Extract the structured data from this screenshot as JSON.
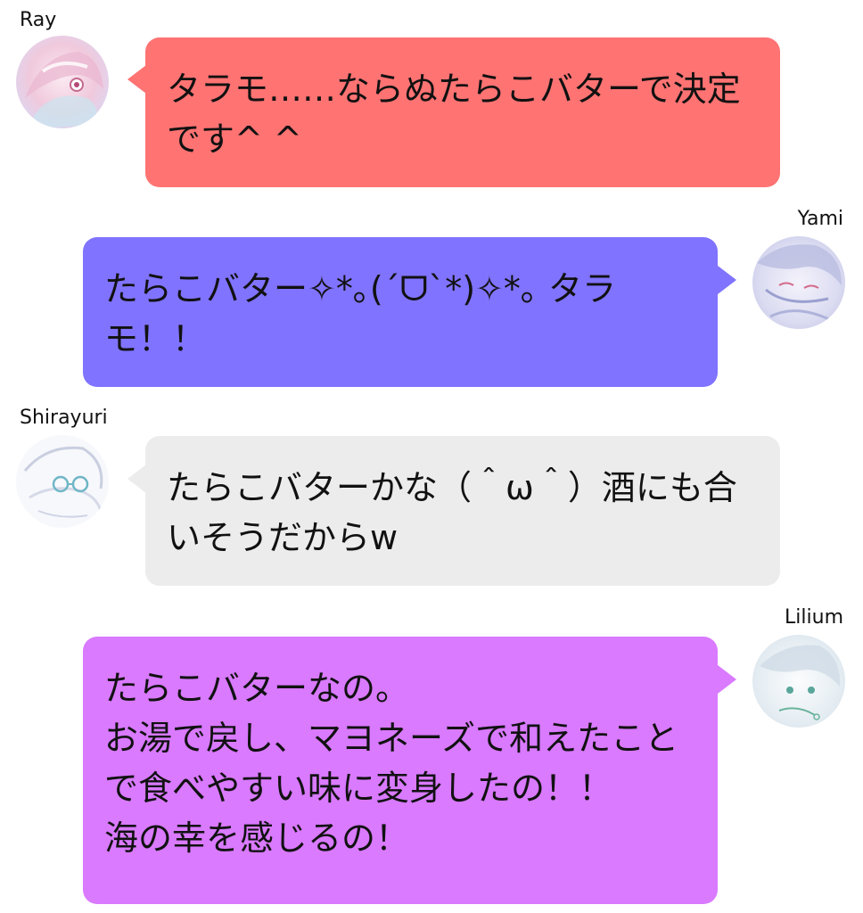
{
  "messages": [
    {
      "sender": "Ray",
      "side": "left",
      "text": "タラモ……ならぬたらこバターで決定です^ ^",
      "color": "#ff7373",
      "avatar_icon": "ray-avatar-icon"
    },
    {
      "sender": "Yami",
      "side": "right",
      "text": "たらこバター✧*｡(ˊᗜˋ*)✧*｡ タラモ！！",
      "color": "#8073ff",
      "avatar_icon": "yami-avatar-icon"
    },
    {
      "sender": "Shirayuri",
      "side": "left",
      "text": "たらこバターかな（＾ω＾）酒にも合いそうだからw",
      "color": "#ececec",
      "avatar_icon": "shirayuri-avatar-icon"
    },
    {
      "sender": "Lilium",
      "side": "right",
      "text": "たらこバターなの。\nお湯で戻し、マヨネーズで和えたことで食べやすい味に変身したの！！\n海の幸を感じるの！",
      "color": "#d97aff",
      "avatar_icon": "lilium-avatar-icon"
    }
  ]
}
